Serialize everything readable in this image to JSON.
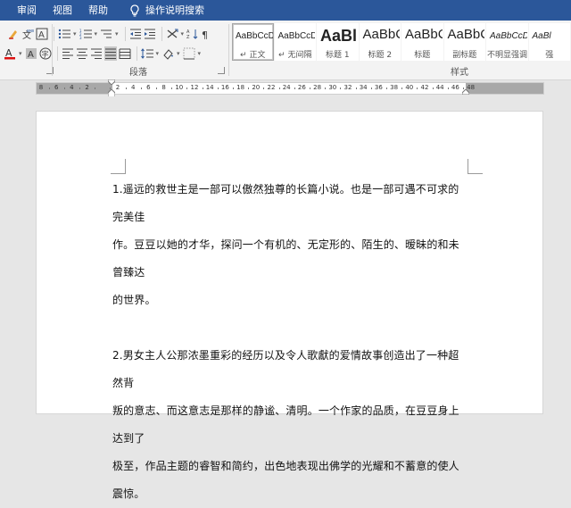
{
  "ribbon_tabs": [
    "审阅",
    "视图",
    "帮助"
  ],
  "tell_me": "操作说明搜索",
  "groups": {
    "paragraph": "段落",
    "styles": "样式"
  },
  "styles": [
    {
      "sample": "AaBbCcDc",
      "name": "正文",
      "prefix": "↵",
      "size": 10,
      "weight": "normal",
      "italic": false,
      "active": true
    },
    {
      "sample": "AaBbCcDc",
      "name": "无间隔",
      "prefix": "↵",
      "size": 10,
      "weight": "normal",
      "italic": false,
      "active": false
    },
    {
      "sample": "AaBl",
      "name": "标题 1",
      "prefix": "",
      "size": 18,
      "weight": "bold",
      "italic": false,
      "active": false
    },
    {
      "sample": "AaBbC",
      "name": "标题 2",
      "prefix": "",
      "size": 15,
      "weight": "normal",
      "italic": false,
      "active": false
    },
    {
      "sample": "AaBbC",
      "name": "标题",
      "prefix": "",
      "size": 15,
      "weight": "normal",
      "italic": false,
      "active": false
    },
    {
      "sample": "AaBbC",
      "name": "副标题",
      "prefix": "",
      "size": 15,
      "weight": "normal",
      "italic": false,
      "active": false
    },
    {
      "sample": "AaBbCcDı",
      "name": "不明显强调",
      "prefix": "",
      "size": 10,
      "weight": "normal",
      "italic": true,
      "active": false
    },
    {
      "sample": "AaBl",
      "name": "强",
      "prefix": "",
      "size": 10,
      "weight": "normal",
      "italic": true,
      "active": false
    }
  ],
  "ruler_numbers": [
    "8",
    "6",
    "4",
    "2",
    "",
    "2",
    "4",
    "6",
    "8",
    "10",
    "12",
    "14",
    "16",
    "18",
    "20",
    "22",
    "24",
    "26",
    "28",
    "30",
    "32",
    "34",
    "36",
    "38",
    "40",
    "42",
    "44",
    "46",
    "48"
  ],
  "paragraphs": [
    [
      "1.遥远的救世主是一部可以傲然独尊的长篇小说。也是一部可遇不可求的完美佳",
      "作。豆豆以她的才华，探问一个有机的、无定形的、陌生的、暧昧的和未曾臻达",
      "的世界。"
    ],
    [
      "2.男女主人公那浓墨重彩的经历以及令人歌獻的爱情故事创造出了一种超然背",
      "叛的意志、而这意志是那样的静谧、清明。一个作家的品质，在豆豆身上达到了",
      "极至，作品主题的睿智和简约，出色地表现出佛学的光耀和不蓄意的使人震惊。"
    ]
  ]
}
